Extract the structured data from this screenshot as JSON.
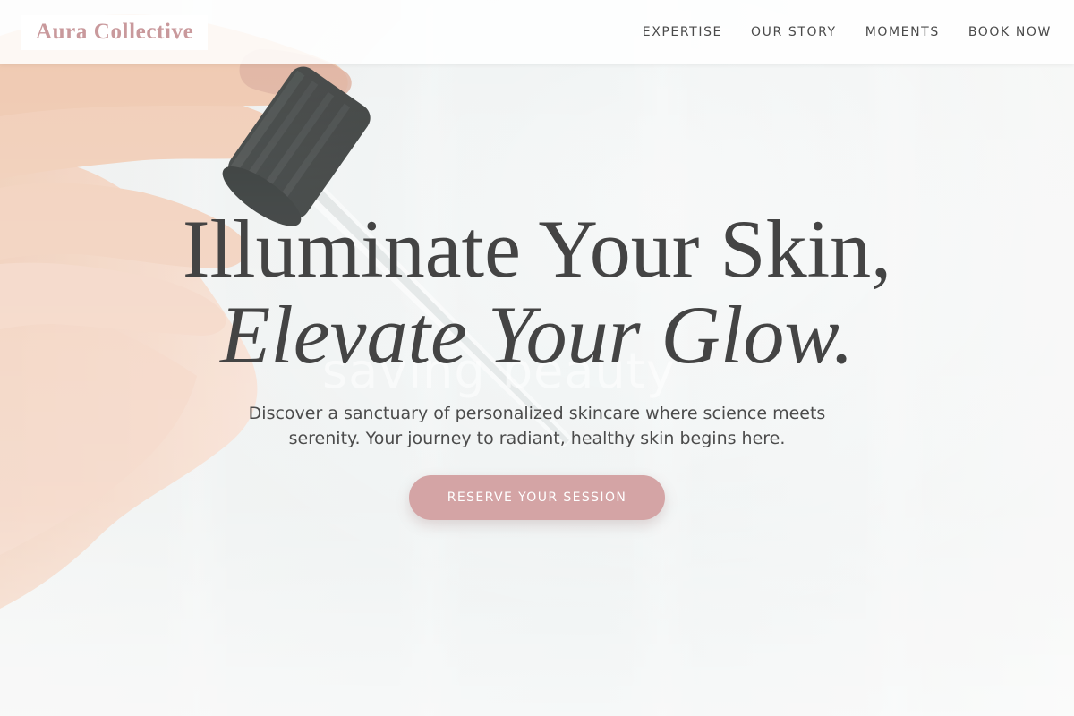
{
  "brand": {
    "name": "Aura Collective"
  },
  "nav": {
    "items": [
      {
        "label": "EXPERTISE"
      },
      {
        "label": "OUR STORY"
      },
      {
        "label": "MOMENTS"
      },
      {
        "label": "BOOK NOW"
      }
    ]
  },
  "hero": {
    "headline_line1": "Illuminate Your Skin,",
    "headline_line2": "Elevate Your Glow.",
    "subtext": "Discover a sanctuary of personalized skincare where science meets serenity. Your journey to radiant, healthy skin begins here.",
    "cta_label": "RESERVE YOUR SESSION",
    "background_text": "saving beauty"
  },
  "colors": {
    "accent": "#d4a4a5",
    "brand_text": "#c9999c",
    "headline_text": "#444444",
    "nav_text": "#4a4a4a"
  }
}
